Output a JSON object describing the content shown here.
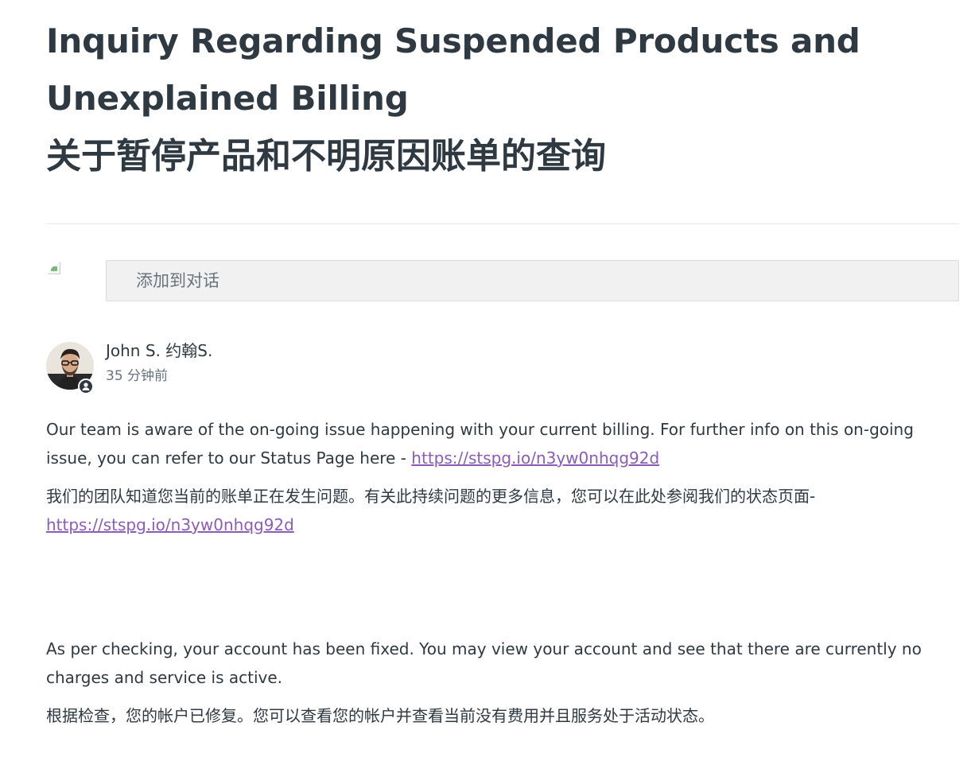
{
  "article": {
    "title_en": "Inquiry Regarding Suspended Products and Unexplained Billing",
    "title_zh": "关于暂停产品和不明原因账单的查询"
  },
  "composer": {
    "placeholder": "添加到对话"
  },
  "comment": {
    "author": "John S. 约翰S.",
    "time": "35 分钟前",
    "paragraph1_en": "Our team is aware of the on-going issue happening with your current billing. For further info on this on-going issue, you can refer to our Status Page here - ",
    "paragraph1_link": "https://stspg.io/n3yw0nhqg92d",
    "paragraph2_zh": "我们的团队知道您当前的账单正在发生问题。有关此持续问题的更多信息，您可以在此处参阅我们的状态页面-",
    "paragraph2_link": "https://stspg.io/n3yw0nhqg92d",
    "paragraph3_en": "As per checking, your account has been fixed. You may view your account and see that there are currently no charges and service is active.",
    "paragraph4_zh": "根据检查，您的帐户已修复。您可以查看您的帐户并查看当前没有费用并且服务处于活动状态。"
  },
  "colors": {
    "text": "#2f3941",
    "muted": "#68737d",
    "link": "#8b5cb8",
    "input_bg": "#f1f1f1"
  }
}
